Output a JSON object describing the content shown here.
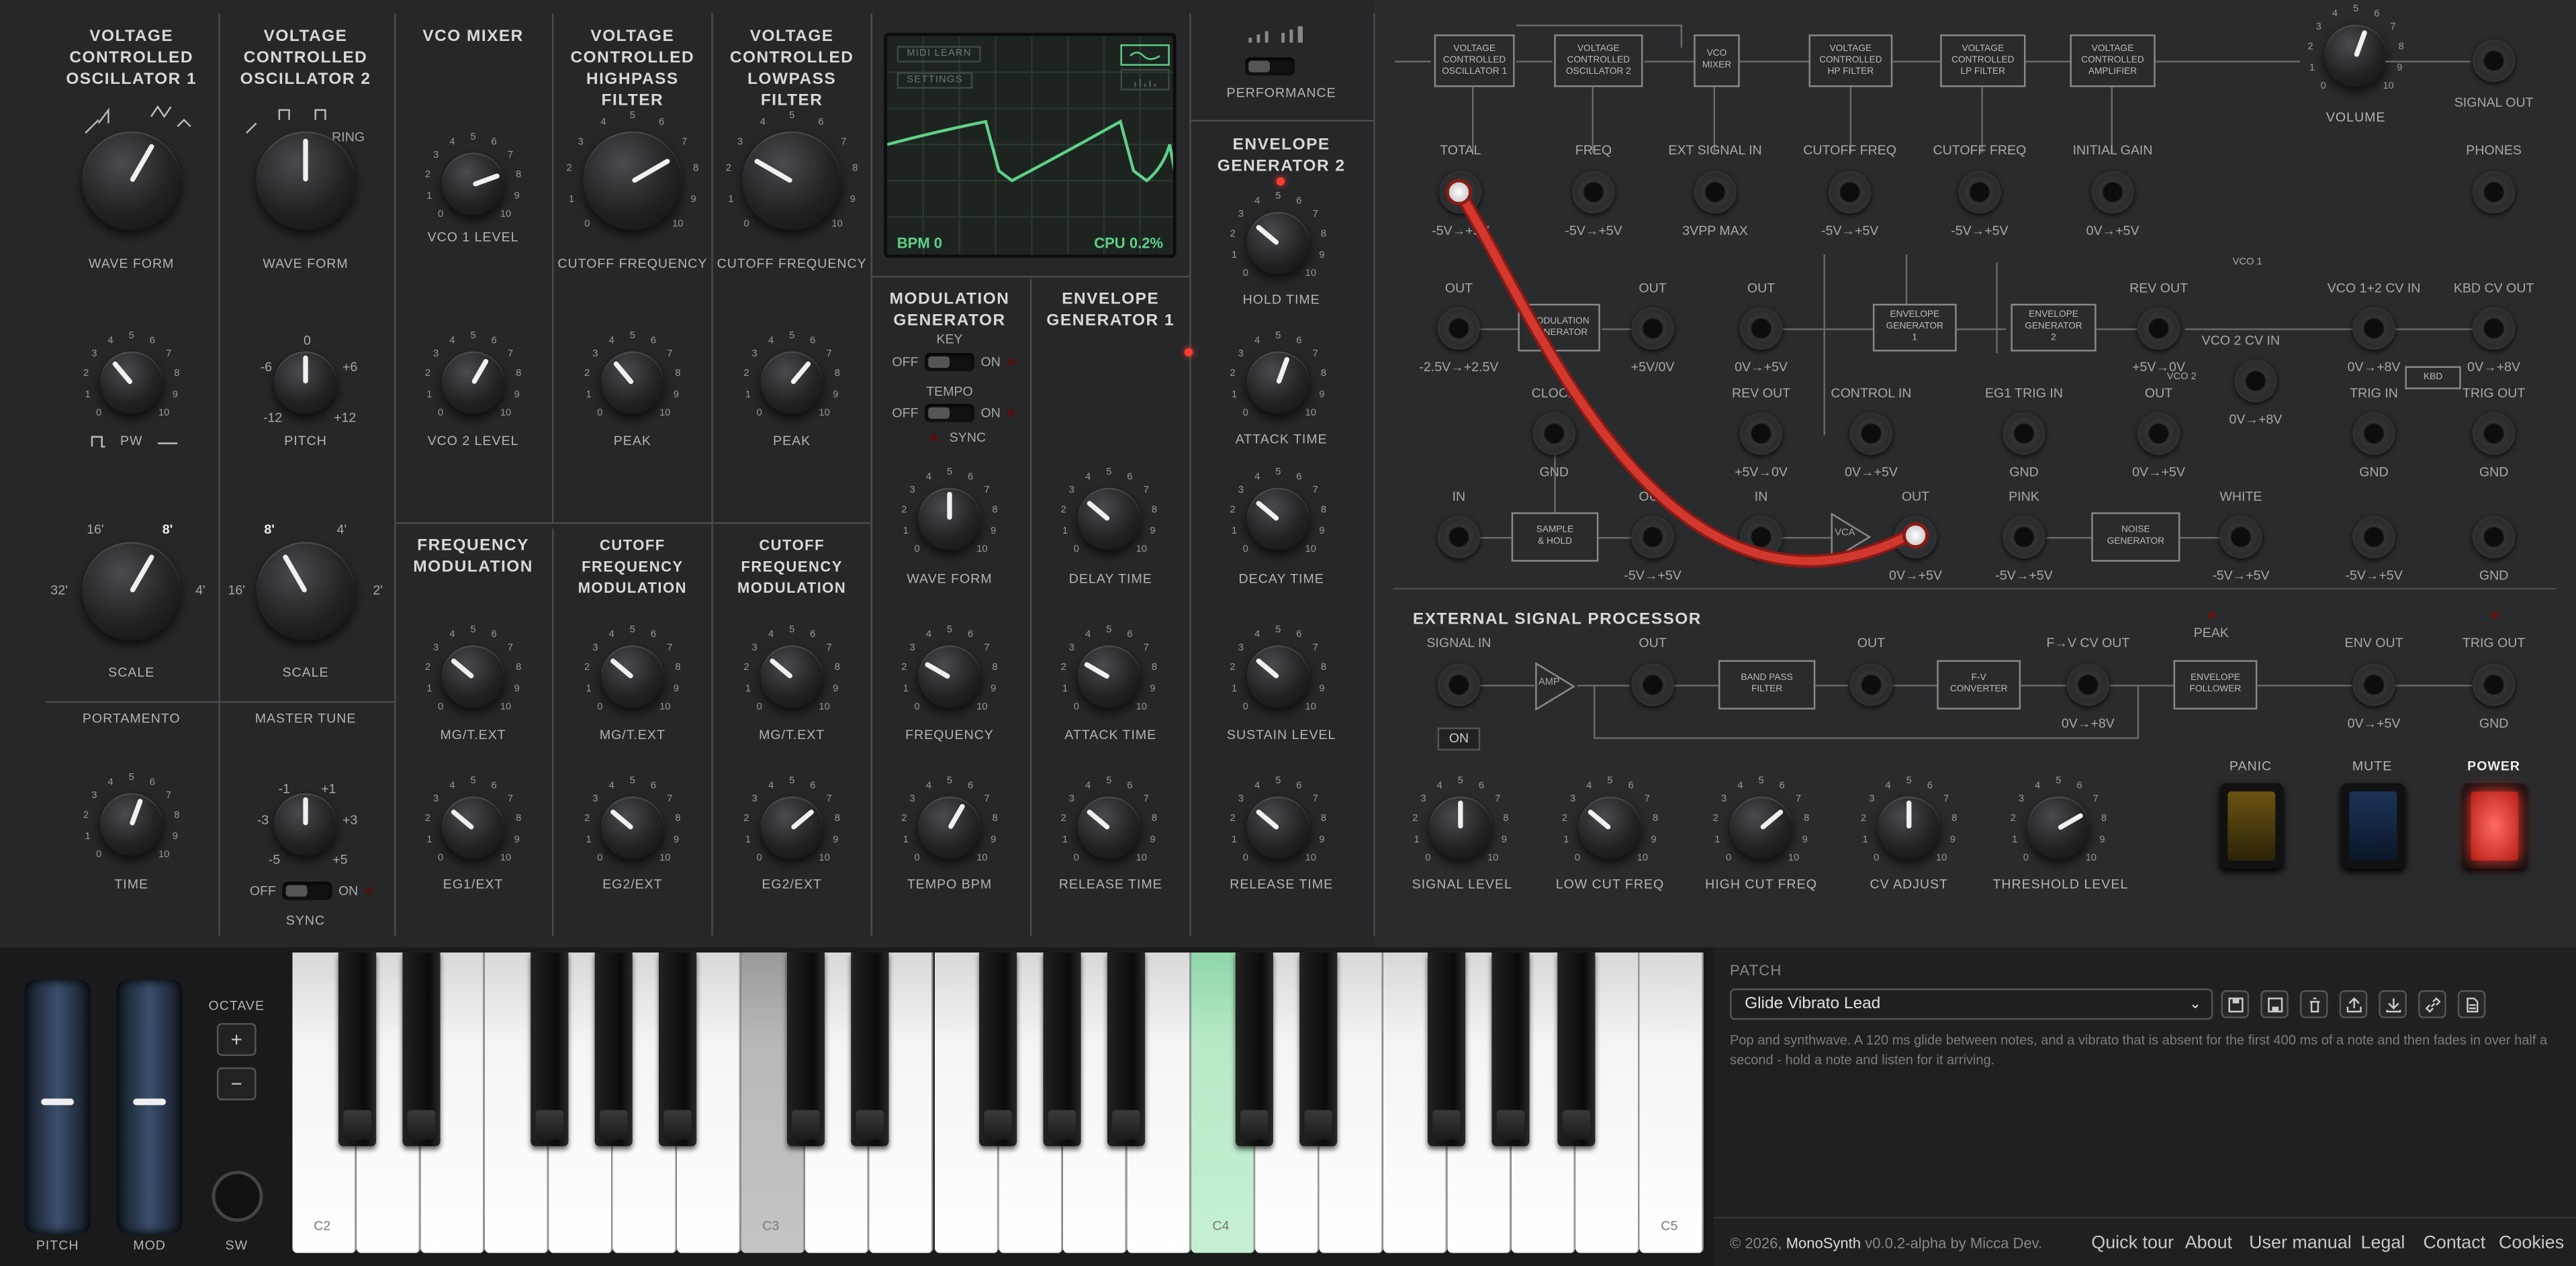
{
  "modules": {
    "vco1": "VOLTAGE\nCONTROLLED\nOSCILLATOR 1",
    "vco2": "VOLTAGE\nCONTROLLED\nOSCILLATOR 2",
    "mixer": "VCO MIXER",
    "hpf": "VOLTAGE\nCONTROLLED\nHIGHPASS FILTER",
    "lpf": "VOLTAGE\nCONTROLLED\nLOWPASS FILTER",
    "fmod": "FREQUENCY\nMODULATION",
    "cfm1": "CUTOFF FREQUENCY\nMODULATION",
    "cfm2": "CUTOFF FREQUENCY\nMODULATION",
    "modgen": "MODULATION\nGENERATOR",
    "eg1": "ENVELOPE\nGENERATOR 1",
    "eg2": "ENVELOPE\nGENERATOR 2",
    "performance": "PERFORMANCE",
    "portamento": "PORTAMENTO",
    "mastertune": "MASTER TUNE",
    "esp": "EXTERNAL SIGNAL PROCESSOR"
  },
  "knobs": {
    "vco1_wave": "WAVE FORM",
    "vco2_wave": "WAVE FORM",
    "vco1_level": "VCO 1 LEVEL",
    "vco2_level": "VCO 2 LEVEL",
    "hp_cutoff": "CUTOFF FREQUENCY",
    "lp_cutoff": "CUTOFF FREQUENCY",
    "hp_peak": "PEAK",
    "lp_peak": "PEAK",
    "pw": "PW",
    "pitch": "PITCH",
    "scale1": "SCALE",
    "scale2": "SCALE",
    "time": "TIME",
    "sync": "SYNC",
    "mgtext1": "MG/T.EXT",
    "mgtext2": "MG/T.EXT",
    "mgtext3": "MG/T.EXT",
    "eg1ext": "EG1/EXT",
    "eg2ext1": "EG2/EXT",
    "eg2ext2": "EG2/EXT",
    "mg_wave": "WAVE FORM",
    "mg_freq": "FREQUENCY",
    "mg_tempo": "TEMPO BPM",
    "eg1_delay": "DELAY TIME",
    "eg1_attack": "ATTACK TIME",
    "eg1_release": "RELEASE TIME",
    "eg2_hold": "HOLD TIME",
    "eg2_attack": "ATTACK TIME",
    "eg2_decay": "DECAY TIME",
    "eg2_sustain": "SUSTAIN LEVEL",
    "eg2_release": "RELEASE TIME",
    "volume": "VOLUME",
    "signal_level": "SIGNAL LEVEL",
    "low_cut": "LOW CUT FREQ",
    "high_cut": "HIGH CUT FREQ",
    "cv_adjust": "CV ADJUST",
    "threshold": "THRESHOLD LEVEL"
  },
  "vco1_wave_marks": {
    "saw": "RING"
  },
  "scale_marks": {
    "a": "16'",
    "b": "8'",
    "c": "32'",
    "d": "4'",
    "e": "8'",
    "f": "4'",
    "g": "16'",
    "h": "2'"
  },
  "pitch_marks": {
    "a": "0",
    "b": "-6",
    "c": "+6",
    "d": "-12",
    "e": "+12"
  },
  "tune_marks": {
    "a": "-1",
    "b": "+1",
    "c": "-3",
    "d": "+3",
    "e": "-5",
    "f": "+5"
  },
  "switches": {
    "off": "OFF",
    "on": "ON",
    "key": "KEY",
    "tempo": "TEMPO",
    "sync": "SYNC"
  },
  "screen": {
    "midi_learn": "MIDI LEARN",
    "settings": "SETTINGS",
    "bpm": "BPM 0",
    "cpu": "CPU 0.2%"
  },
  "patch_labels": {
    "total": "TOTAL",
    "freq": "FREQ",
    "ext_signal_in": "EXT SIGNAL IN",
    "cutoff1": "CUTOFF FREQ",
    "cutoff2": "CUTOFF FREQ",
    "initial_gain": "INITIAL GAIN",
    "phones": "PHONES",
    "signal_out": "SIGNAL OUT",
    "out1": "OUT",
    "out2": "OUT",
    "out3": "OUT",
    "rev_out": "REV OUT",
    "vco12cv": "VCO 1+2 CV IN",
    "kbd_cv": "KBD CV OUT",
    "vco2cv": "VCO 2 CV IN",
    "clock": "CLOCK",
    "rev_out2": "REV OUT",
    "control_in": "CONTROL IN",
    "eg1trig": "EG1 TRIG IN",
    "out4": "OUT",
    "trig_in": "TRIG IN",
    "trig_out": "TRIG OUT",
    "in1": "IN",
    "out5": "OUT",
    "in2": "IN",
    "out6": "OUT",
    "pink": "PINK",
    "white": "WHITE",
    "signal_in": "SIGNAL IN",
    "esp_out": "OUT",
    "esp_out2": "OUT",
    "fv_out": "F→V CV OUT",
    "env_out": "ENV OUT",
    "trig_out2": "TRIG OUT",
    "peak": "PEAK",
    "on_btn": "ON"
  },
  "ranges": {
    "r1": "-5V→+5V",
    "r2": "-5V→+5V",
    "r3": "3VPP MAX",
    "r4": "-5V→+5V",
    "r5": "-5V→+5V",
    "r6": "0V→+5V",
    "r7": "-2.5V→+2.5V",
    "r8": "+5V/0V",
    "r9": "0V→+5V",
    "r10": "+5V→0V",
    "r11": "0V→+8V",
    "r12": "0V→+8V",
    "r13": "GND",
    "r14": "+5V→0V",
    "r15": "0V→+5V",
    "r16": "GND",
    "r17": "0V→+5V",
    "r18": "0V→+8V",
    "r19": "GND",
    "r20": "GND",
    "r21": "-5V→+5V",
    "r22": "0V→+5V",
    "r23": "-5V→+5V",
    "r24": "-5V→+5V",
    "r25": "-5V→+5V",
    "r26": "GND",
    "r27": "0V→+8V",
    "r28": "0V→+5V",
    "r29": "GND"
  },
  "boxes": {
    "b_vco1": "VOLTAGE\nCONTROLLED\nOSCILLATOR 1",
    "b_vco2": "VOLTAGE\nCONTROLLED\nOSCILLATOR 2",
    "b_mix": "VCO\nMIXER",
    "b_hp": "VOLTAGE\nCONTROLLED\nHP FILTER",
    "b_lp": "VOLTAGE\nCONTROLLED\nLP FILTER",
    "b_amp": "VOLTAGE\nCONTROLLED\nAMPLIFIER",
    "b_mg": "MODULATION\nGENERATOR",
    "b_eg1": "ENVELOPE\nGENERATOR\n1",
    "b_eg2": "ENVELOPE\nGENERATOR\n2",
    "b_kbd": "KBD",
    "b_sh": "SAMPLE\n& HOLD",
    "b_vca": "VCA",
    "b_noise": "NOISE\nGENERATOR",
    "b_amp2": "AMP",
    "b_bpf": "BAND PASS\nFILTER",
    "b_fv": "F-V\nCONVERTER",
    "b_envf": "ENVELOPE\nFOLLOWER",
    "vco1_tag": "VCO 1",
    "vco2_tag": "VCO 2"
  },
  "buttons": {
    "panic": "PANIC",
    "mute": "MUTE",
    "power": "POWER",
    "octave": "OCTAVE",
    "plus": "+",
    "minus": "−",
    "pitch": "PITCH",
    "mod": "MOD",
    "sw": "SW"
  },
  "keys": {
    "c2": "C2",
    "c3": "C3",
    "c4": "C4",
    "c5": "C5"
  },
  "patch": {
    "header": "PATCH",
    "name": "Glide Vibrato Lead",
    "description": "Pop and synthwave. A 120 ms glide between notes, and a vibrato that is absent for the first 400 ms of a note and then fades in over half a second - hold a note and listen for it arriving."
  },
  "footer": {
    "copyright": "© 2026,",
    "app": "MonoSynth",
    "version": "v0.0.2-alpha by Micca Dev.",
    "links": [
      "Quick tour",
      "About",
      "User manual",
      "Legal",
      "Contact",
      "Cookies"
    ]
  }
}
